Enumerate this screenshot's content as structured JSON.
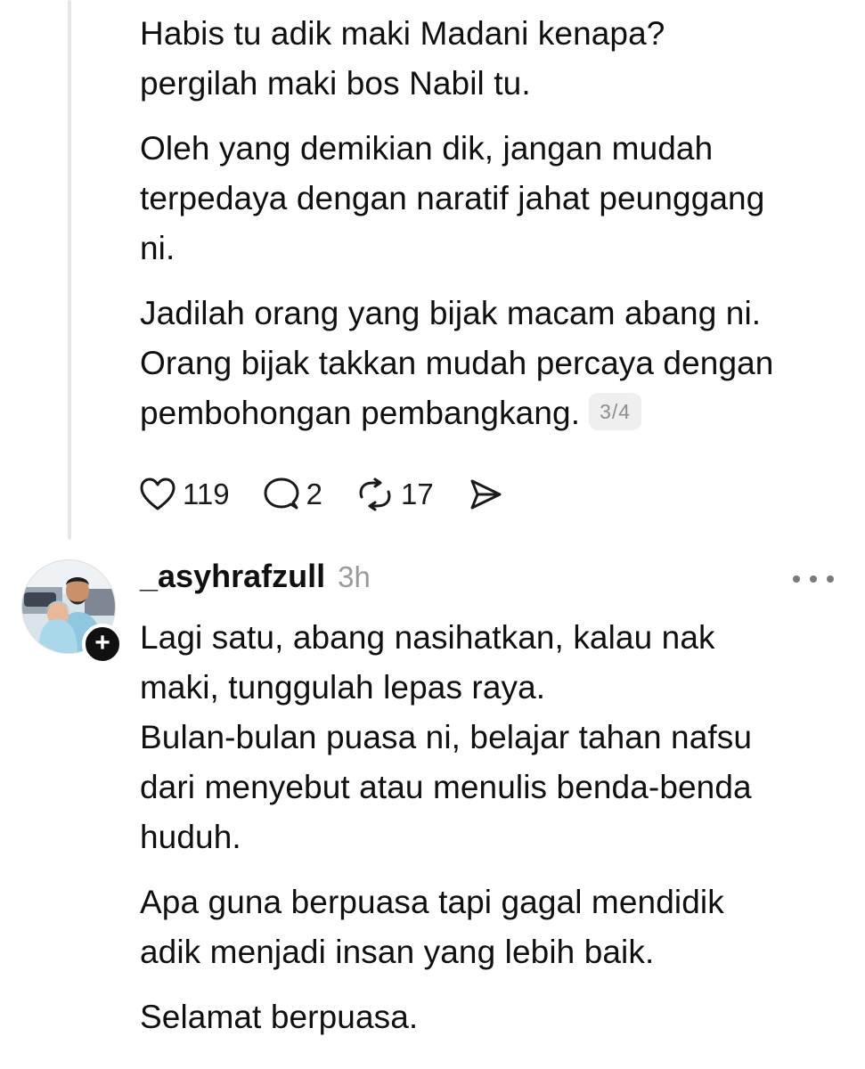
{
  "first_post": {
    "paragraphs": [
      [
        "Habis tu adik maki Madani kenapa?",
        "pergilah maki bos Nabil tu."
      ],
      [
        "Oleh yang demikian dik, jangan mudah",
        "terpedaya dengan naratif jahat peunggang",
        "ni."
      ],
      [
        "Jadilah orang yang bijak macam abang ni.",
        "Orang bijak takkan mudah percaya dengan",
        "pembohongan pembangkang."
      ]
    ],
    "thread_counter": "3/4",
    "actions": {
      "likes": "119",
      "replies": "2",
      "reposts": "17"
    }
  },
  "second_post": {
    "username": "_asyhrafzull",
    "time": "3h",
    "follow_symbol": "+",
    "paragraphs": [
      [
        "Lagi satu, abang nasihatkan, kalau nak",
        "maki, tunggulah lepas raya.",
        "Bulan-bulan puasa ni, belajar tahan nafsu",
        "dari menyebut atau menulis benda-benda",
        "huduh."
      ],
      [
        "Apa guna berpuasa tapi gagal mendidik",
        "adik menjadi insan yang lebih baik."
      ],
      [
        "Selamat berpuasa."
      ]
    ]
  },
  "icons": {
    "like": "heart-icon",
    "reply": "comment-icon",
    "repost": "repost-icon",
    "share": "send-icon",
    "more": "more-dots-icon"
  }
}
